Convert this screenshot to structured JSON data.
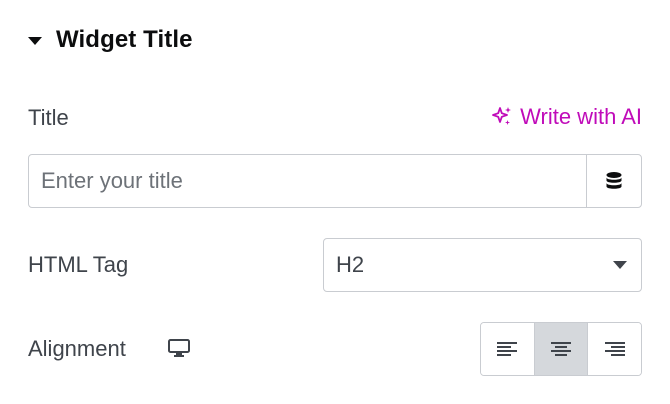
{
  "section": {
    "title": "Widget Title",
    "icon": "caret-down-icon"
  },
  "title_field": {
    "label": "Title",
    "ai_button_label": "Write with AI",
    "ai_icon": "sparkle-icon",
    "placeholder": "Enter your title",
    "value": "",
    "dynamic_icon": "database-icon"
  },
  "html_tag_field": {
    "label": "HTML Tag",
    "selected": "H2"
  },
  "alignment_field": {
    "label": "Alignment",
    "device_icon": "monitor-icon",
    "options": [
      "align-left",
      "align-center",
      "align-right"
    ],
    "selected": "align-center"
  },
  "colors": {
    "ai_accent": "#c00bb9",
    "text": "#3f444b",
    "heading": "#0c0d0e",
    "border": "#c9ccd1",
    "active_bg": "#d5d8dc"
  }
}
